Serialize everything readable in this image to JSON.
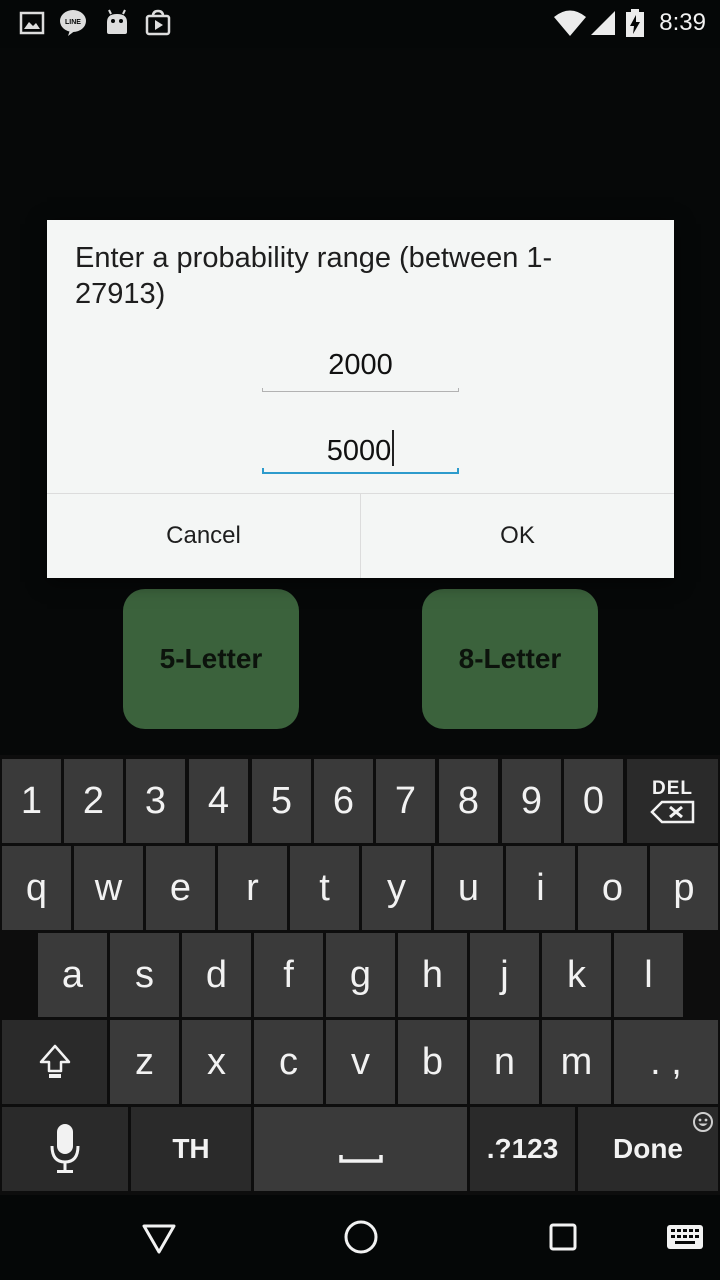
{
  "status_bar": {
    "time": "8:39",
    "icons": [
      "gallery-icon",
      "line-icon",
      "android-icon",
      "play-store-icon",
      "wifi-icon",
      "signal-icon",
      "battery-charging-icon"
    ]
  },
  "app": {
    "buttons": [
      {
        "label": "5-Letter"
      },
      {
        "label": "8-Letter"
      }
    ],
    "button_color": "#3b623c"
  },
  "dialog": {
    "title": "Enter a probability range (between 1-27913)",
    "min_value": "2000",
    "max_value": "5000",
    "cancel_label": "Cancel",
    "ok_label": "OK",
    "focus_color": "#2d9bcc"
  },
  "keyboard": {
    "row1": [
      "1",
      "2",
      "3",
      "4",
      "5",
      "6",
      "7",
      "8",
      "9",
      "0"
    ],
    "del_label": "DEL",
    "row2": [
      "q",
      "w",
      "e",
      "r",
      "t",
      "y",
      "u",
      "i",
      "o",
      "p"
    ],
    "row3": [
      "a",
      "s",
      "d",
      "f",
      "g",
      "h",
      "j",
      "k",
      "l"
    ],
    "row4": [
      "z",
      "x",
      "c",
      "v",
      "b",
      "n",
      "m"
    ],
    "punct_label": ". ,",
    "lang_label": "TH",
    "symbols_label": ".?123",
    "done_label": "Done"
  },
  "nav_bar": {
    "icons": [
      "back-icon",
      "home-icon",
      "recents-icon",
      "keyboard-icon"
    ]
  }
}
